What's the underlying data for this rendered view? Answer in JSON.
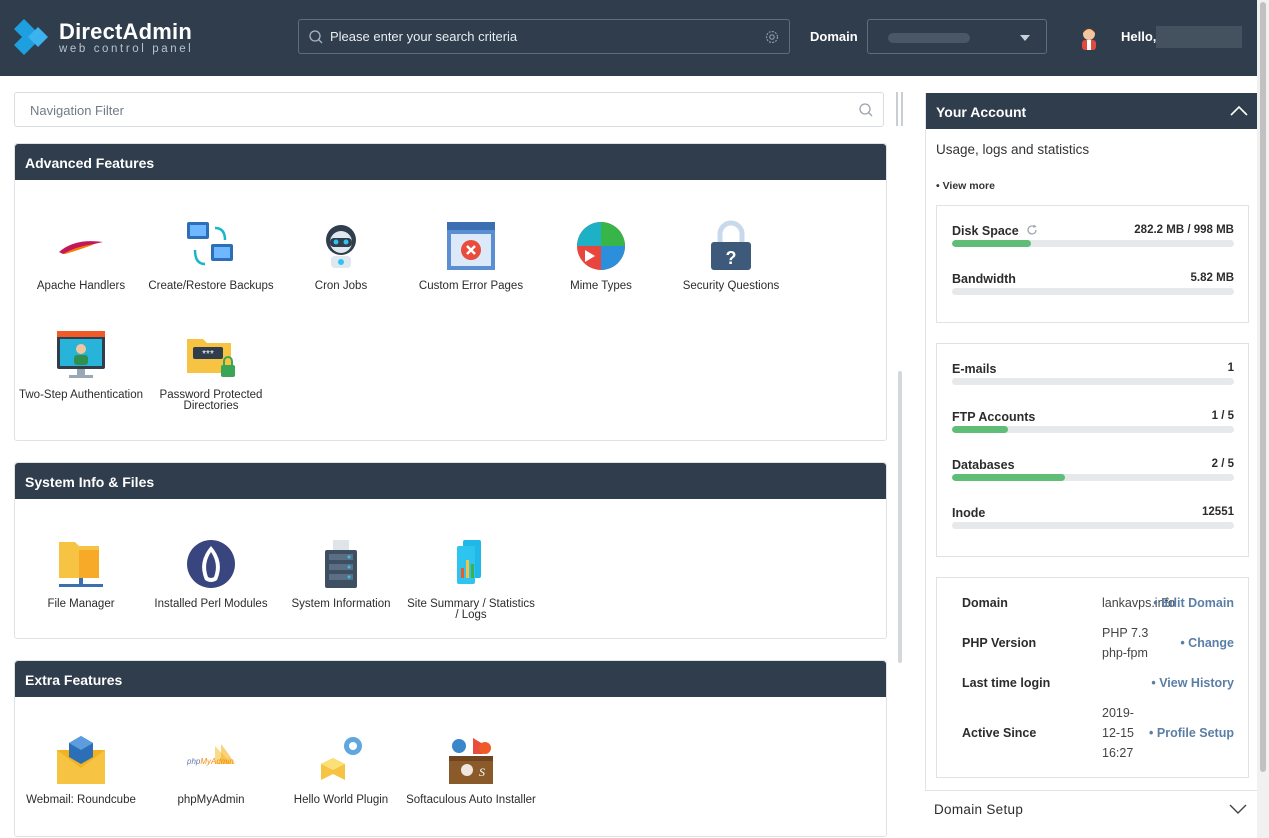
{
  "header": {
    "logo_title": "DirectAdmin",
    "logo_subtitle": "web control panel",
    "search_placeholder": "Please enter your search criteria",
    "domain_label": "Domain",
    "hello": "Hello,"
  },
  "nav_filter": {
    "placeholder": "Navigation Filter"
  },
  "panels": {
    "advanced": {
      "title": "Advanced Features",
      "items": [
        "Apache Handlers",
        "Create/Restore Backups",
        "Cron Jobs",
        "Custom Error Pages",
        "Mime Types",
        "Security Questions",
        "Two-Step Authentication",
        "Password Protected Directories"
      ]
    },
    "system": {
      "title": "System Info & Files",
      "items": [
        "File Manager",
        "Installed Perl Modules",
        "System Information",
        "Site Summary / Statistics / Logs"
      ]
    },
    "extra": {
      "title": "Extra Features",
      "items": [
        "Webmail: Roundcube",
        "phpMyAdmin",
        "Hello World Plugin",
        "Softaculous Auto Installer"
      ]
    }
  },
  "account": {
    "title": "Your Account",
    "subtitle": "Usage, logs and statistics",
    "view_more": "• View more",
    "usage": [
      {
        "name": "Disk Space",
        "value": "282.2 MB / 998 MB",
        "fraction": 0.28
      },
      {
        "name": "Bandwidth",
        "value": "5.82 MB",
        "fraction": 0
      }
    ],
    "counts": [
      {
        "name": "E-mails",
        "value": "1",
        "fraction": 0
      },
      {
        "name": "FTP Accounts",
        "value": "1 / 5",
        "fraction": 0.2
      },
      {
        "name": "Databases",
        "value": "2 / 5",
        "fraction": 0.4
      },
      {
        "name": "Inode",
        "value": "12551",
        "fraction": 0
      }
    ],
    "info": [
      {
        "key": "Domain",
        "value": "lankavps.info",
        "action": "• Edit Domain"
      },
      {
        "key": "PHP Version",
        "value": "PHP 7.3 php-fpm",
        "action": "• Change"
      },
      {
        "key": "Last time login",
        "value": "",
        "action": "• View History"
      },
      {
        "key": "Active Since",
        "value": "2019-12-15 16:27",
        "action": "• Profile Setup"
      }
    ]
  },
  "domain_setup": {
    "title": "Domain Setup"
  },
  "colors": {
    "header": "#2f3d4c",
    "accent": "#5fbd78",
    "link": "#5b7ea6"
  }
}
